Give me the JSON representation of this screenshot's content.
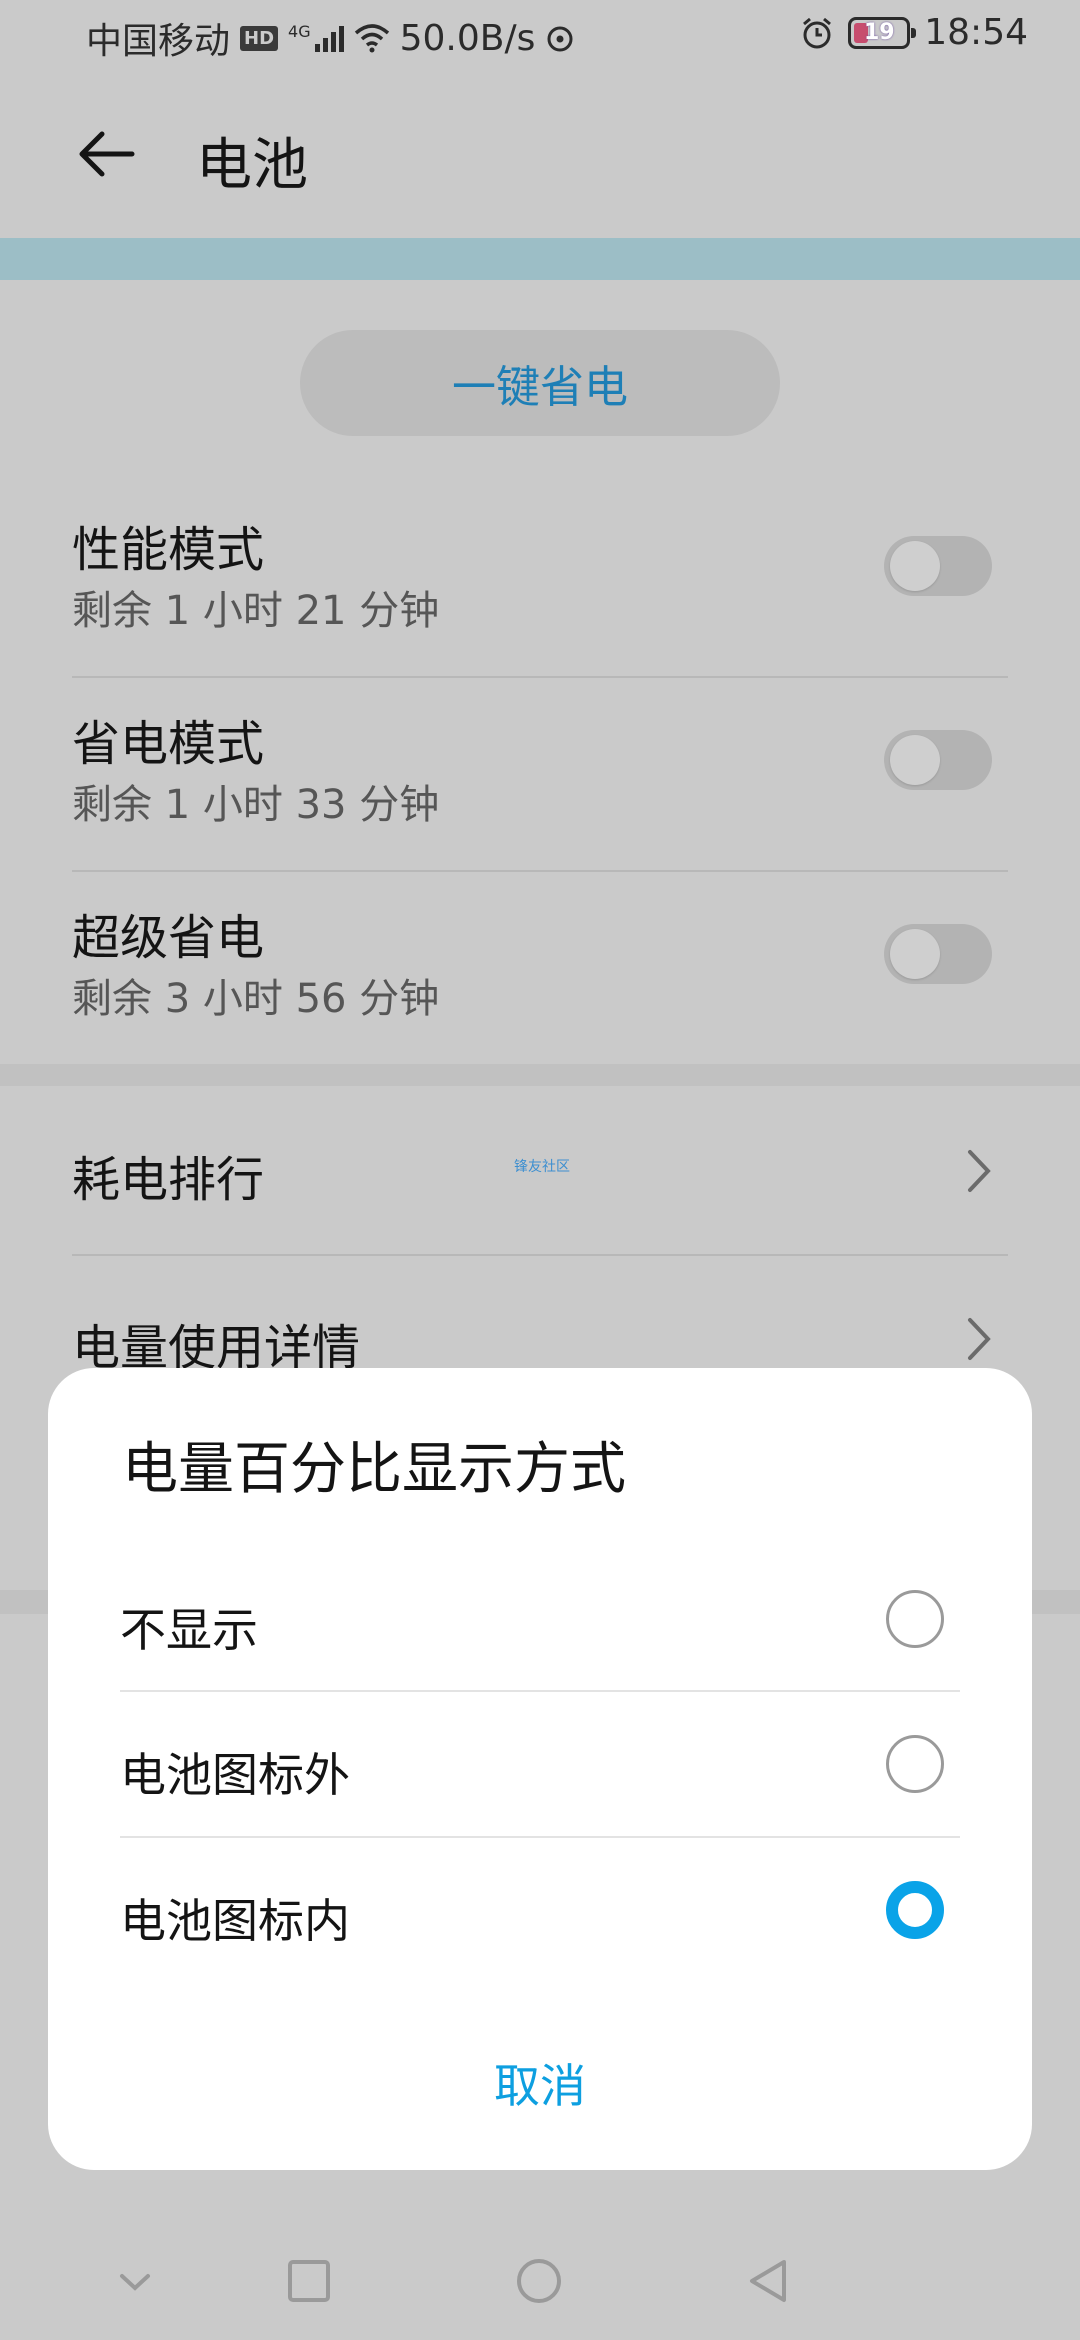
{
  "status": {
    "carrier": "中国移动",
    "hd": "HD",
    "net": "4G",
    "speed": "50.0B/s",
    "battery_level": "19",
    "time": "18:54"
  },
  "header": {
    "title": "电池"
  },
  "one_key": {
    "label": "一键省电"
  },
  "modes": [
    {
      "title": "性能模式",
      "sub": "剩余 1 小时 21 分钟"
    },
    {
      "title": "省电模式",
      "sub": "剩余 1 小时 33 分钟"
    },
    {
      "title": "超级省电",
      "sub": "剩余 3 小时 56 分钟"
    }
  ],
  "list": [
    {
      "label": "耗电排行"
    },
    {
      "label": "电量使用详情"
    }
  ],
  "watermark": "锋友社区",
  "dialog": {
    "title": "电量百分比显示方式",
    "options": [
      {
        "label": "不显示",
        "selected": false
      },
      {
        "label": "电池图标外",
        "selected": false
      },
      {
        "label": "电池图标内",
        "selected": true
      }
    ],
    "cancel": "取消"
  },
  "colors": {
    "accent": "#0aa3e8",
    "banner": "#9cbec6",
    "link": "#1e7fb6"
  }
}
